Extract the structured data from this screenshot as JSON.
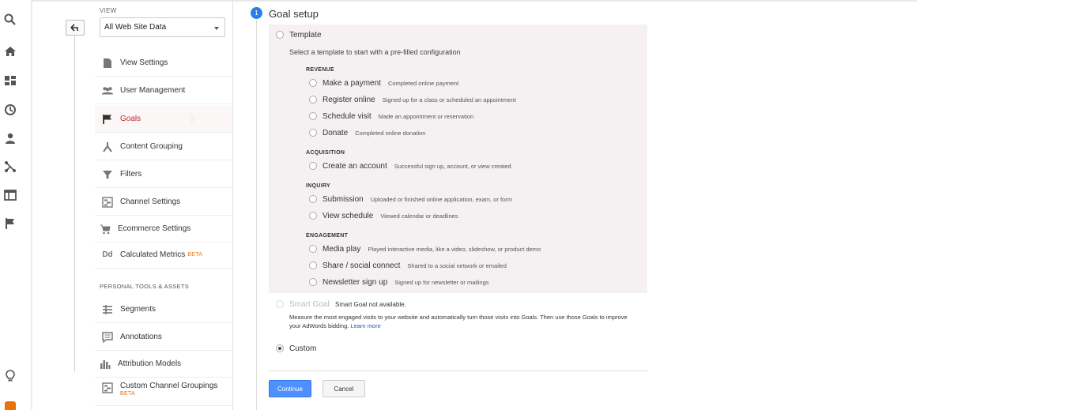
{
  "colors": {
    "accent": "#4d90fe",
    "active_nav": "#c62828",
    "beta": "#e8710a",
    "step": "#2b7de9"
  },
  "rail": {
    "icons": [
      "search-icon",
      "home-icon",
      "customization-icon",
      "realtime-icon",
      "audience-icon",
      "acquisition-icon",
      "behavior-icon",
      "conversions-icon",
      "lightbulb-icon"
    ]
  },
  "admin": {
    "view_label": "VIEW",
    "view_selected": "All Web Site Data",
    "nav": [
      {
        "label": "View Settings",
        "icon": "document-icon"
      },
      {
        "label": "User Management",
        "icon": "users-icon"
      },
      {
        "label": "Goals",
        "icon": "flag-icon",
        "active": true
      },
      {
        "label": "Content Grouping",
        "icon": "content-grouping-icon"
      },
      {
        "label": "Filters",
        "icon": "filter-icon"
      },
      {
        "label": "Channel Settings",
        "icon": "channel-icon"
      },
      {
        "label": "Ecommerce Settings",
        "icon": "cart-icon"
      },
      {
        "label": "Calculated Metrics",
        "icon": "dd-icon",
        "badge": "BETA"
      }
    ],
    "section_label": "PERSONAL TOOLS & ASSETS",
    "tools": [
      {
        "label": "Segments",
        "icon": "segments-icon"
      },
      {
        "label": "Annotations",
        "icon": "annotation-icon"
      },
      {
        "label": "Attribution Models",
        "icon": "bar-chart-icon"
      },
      {
        "label": "Custom Channel Groupings",
        "icon": "channel-icon",
        "badge": "BETA"
      }
    ]
  },
  "goal": {
    "step": "1",
    "title": "Goal setup",
    "template_label": "Template",
    "template_desc": "Select a template to start with a pre-filled configuration",
    "categories": [
      {
        "name": "REVENUE",
        "options": [
          {
            "name": "Make a payment",
            "desc": "Completed online payment"
          },
          {
            "name": "Register online",
            "desc": "Signed up for a class or scheduled an appointment"
          },
          {
            "name": "Schedule visit",
            "desc": "Made an appointment or reservation"
          },
          {
            "name": "Donate",
            "desc": "Completed online donation"
          }
        ]
      },
      {
        "name": "ACQUISITION",
        "options": [
          {
            "name": "Create an account",
            "desc": "Successful sign up, account, or view created"
          }
        ]
      },
      {
        "name": "INQUIRY",
        "options": [
          {
            "name": "Submission",
            "desc": "Uploaded or finished online application, exam, or form"
          },
          {
            "name": "View schedule",
            "desc": "Viewed calendar or deadlines"
          }
        ]
      },
      {
        "name": "ENGAGEMENT",
        "options": [
          {
            "name": "Media play",
            "desc": "Played interactive media, like a video, slideshow, or product demo"
          },
          {
            "name": "Share / social connect",
            "desc": "Shared to a social network or emailed"
          },
          {
            "name": "Newsletter sign up",
            "desc": "Signed up for newsletter or mailings"
          }
        ]
      }
    ],
    "smart_label": "Smart Goal",
    "smart_na": "Smart Goal not available.",
    "smart_desc": "Measure the most engaged visits to your website and automatically turn those visits into Goals. Then use those Goals to improve your AdWords bidding.",
    "learn_more": "Learn more",
    "custom_label": "Custom",
    "continue_label": "Continue",
    "cancel_label": "Cancel"
  }
}
